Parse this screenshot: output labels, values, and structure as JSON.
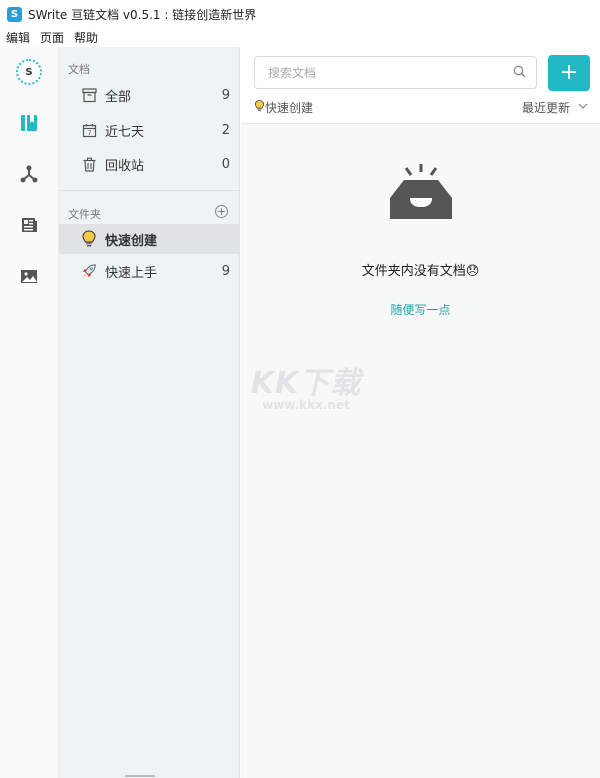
{
  "window": {
    "logo_letter": "S",
    "title": "SWrite 亘链文档 v0.5.1 : 链接创造新世界"
  },
  "menubar": {
    "items": [
      "编辑",
      "页面",
      "帮助"
    ]
  },
  "rail": {
    "avatar_letter": "S",
    "icons": [
      "notebook-icon",
      "graph-icon",
      "newspaper-icon",
      "image-icon"
    ]
  },
  "panel": {
    "docs_section": "文档",
    "docs": [
      {
        "label": "全部",
        "count": "9",
        "icon": "inbox-icon"
      },
      {
        "label": "近七天",
        "count": "2",
        "icon": "calendar-icon"
      },
      {
        "label": "回收站",
        "count": "0",
        "icon": "trash-icon"
      }
    ],
    "folders_section": "文件夹",
    "folders": [
      {
        "label": "快速创建",
        "count": "",
        "icon": "lightbulb-icon",
        "active": true
      },
      {
        "label": "快速上手",
        "count": "9",
        "icon": "rocket-icon",
        "active": false
      }
    ]
  },
  "main": {
    "search_placeholder": "搜索文档",
    "add_label": "+",
    "current_folder": "快速创建",
    "sort_label": "最近更新",
    "empty_text": "文件夹内没有文档😞",
    "empty_link": "随便写一点"
  },
  "watermark": {
    "big": "KK下载",
    "small": "www.kkx.net"
  },
  "colors": {
    "accent": "#20b9c4",
    "link": "#1fa3ae",
    "panel_bg": "#eef3f4",
    "active_row": "#dfe3e6"
  }
}
